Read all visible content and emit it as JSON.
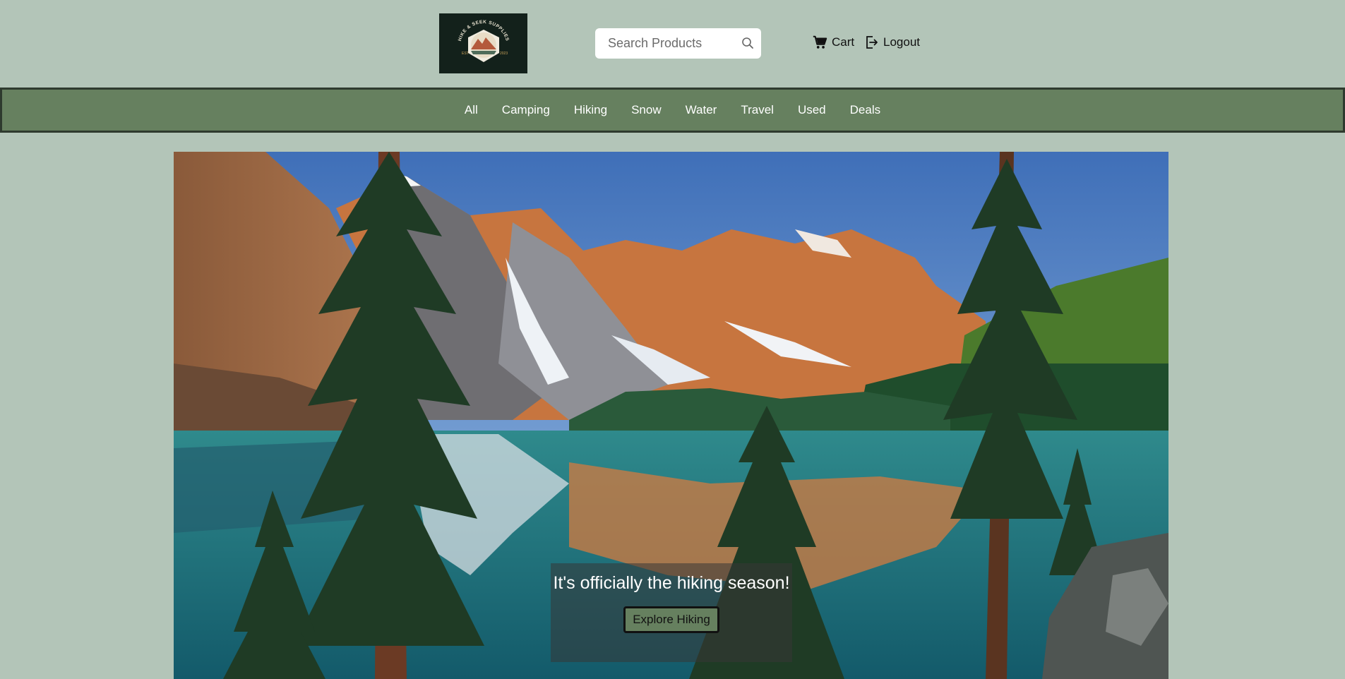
{
  "header": {
    "logo": {
      "text_top": "HIKE & SEEK SUPPLIES",
      "text_left": "EST",
      "text_right": "2023",
      "background": "#13211b",
      "icon": "mountain-badge-logo"
    },
    "search": {
      "placeholder": "Search Products",
      "value": "",
      "icon": "search-icon"
    },
    "cart": {
      "label": "Cart",
      "icon": "cart-icon"
    },
    "logout": {
      "label": "Logout",
      "icon": "logout-icon"
    }
  },
  "nav": {
    "items": [
      {
        "label": "All"
      },
      {
        "label": "Camping"
      },
      {
        "label": "Hiking"
      },
      {
        "label": "Snow"
      },
      {
        "label": "Water"
      },
      {
        "label": "Travel"
      },
      {
        "label": "Used"
      },
      {
        "label": "Deals"
      }
    ]
  },
  "hero": {
    "image": "mountain-lake-landscape",
    "caption": "It's officially the hiking season!",
    "button_label": "Explore Hiking"
  },
  "colors": {
    "page_bg": "#b3c5b8",
    "nav_bg": "#66805f",
    "nav_border": "#2e3a2e",
    "button_bg": "#66805f",
    "logo_bg": "#13211b"
  }
}
